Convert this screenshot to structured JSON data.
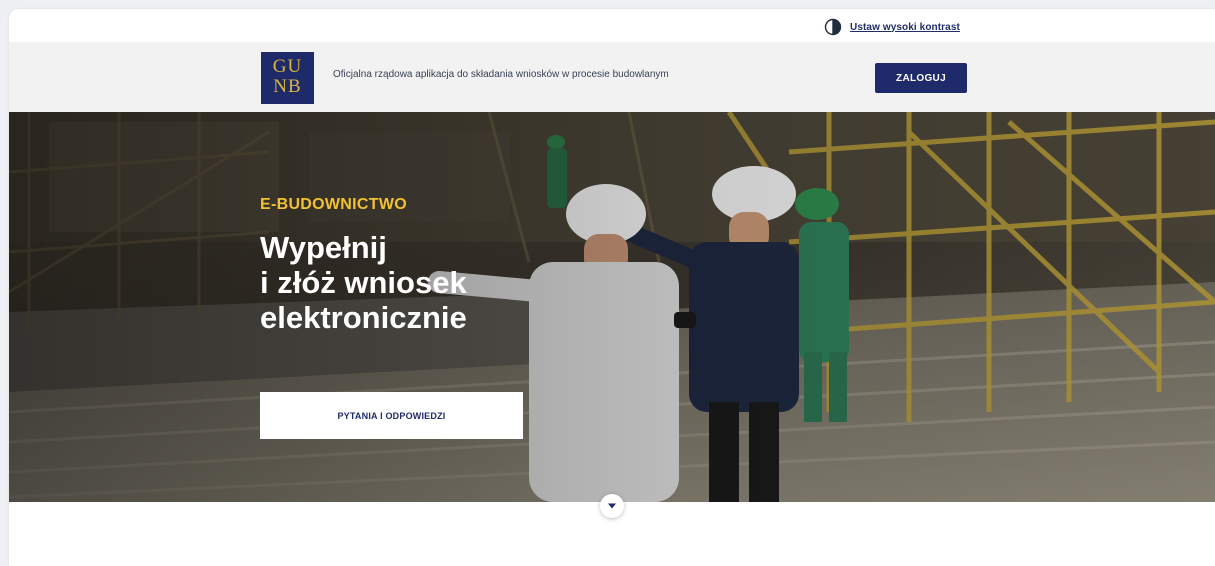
{
  "topbar": {
    "contrast_label": "Ustaw wysoki kontrast",
    "contrast_icon": "contrast-icon"
  },
  "header": {
    "logo_line1": "GU",
    "logo_line2": "NB",
    "tagline": "Oficjalna rządowa aplikacja do składania wniosków w procesie budowlanym",
    "login_label": "ZALOGUJ"
  },
  "hero": {
    "eyebrow": "E-BUDOWNICTWO",
    "headline_lines": [
      "Wypełnij",
      "i złóż wniosek",
      "elektronicznie"
    ],
    "faq_button": "PYTANIA I ODPOWIEDZI",
    "scroll_icon": "chevron-down-icon"
  },
  "colors": {
    "brand_navy": "#1f2a6b",
    "accent_yellow": "#f2c233",
    "logo_gold": "#d9b63a"
  }
}
